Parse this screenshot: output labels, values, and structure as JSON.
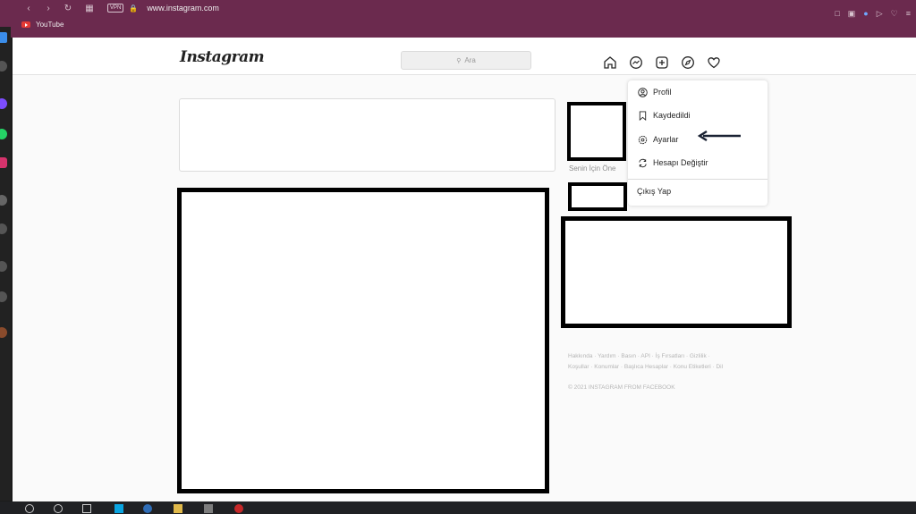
{
  "browser": {
    "url": "www.instagram.com",
    "vpn_label": "VPN",
    "bookmark_label": "YouTube",
    "colors": {
      "chrome": "#6b2a4e",
      "page_bg": "#fafafa"
    }
  },
  "header": {
    "logo_text": "Instagram",
    "search_placeholder": "Ara",
    "nav_icons": [
      "home-icon",
      "messenger-icon",
      "new-post-icon",
      "explore-icon",
      "activity-heart-icon"
    ]
  },
  "sidebar": {
    "suggest_label": "Senin İçin Öne",
    "footer_links_line1": "Hakkında · Yardım · Basın · API · İş Fırsatları · Gizlilik ·",
    "footer_links_line2": "Koşullar · Konumlar · Başlıca Hesaplar · Konu Etiketleri · Dil",
    "copyright": "© 2021 INSTAGRAM FROM FACEBOOK"
  },
  "dropdown": {
    "items": [
      {
        "label": "Profil",
        "icon": "profile-icon"
      },
      {
        "label": "Kaydedildi",
        "icon": "bookmark-icon"
      },
      {
        "label": "Ayarlar",
        "icon": "settings-gear-icon"
      },
      {
        "label": "Hesapı Değiştir",
        "icon": "switch-account-icon"
      }
    ],
    "logout_label": "Çıkış Yap"
  }
}
